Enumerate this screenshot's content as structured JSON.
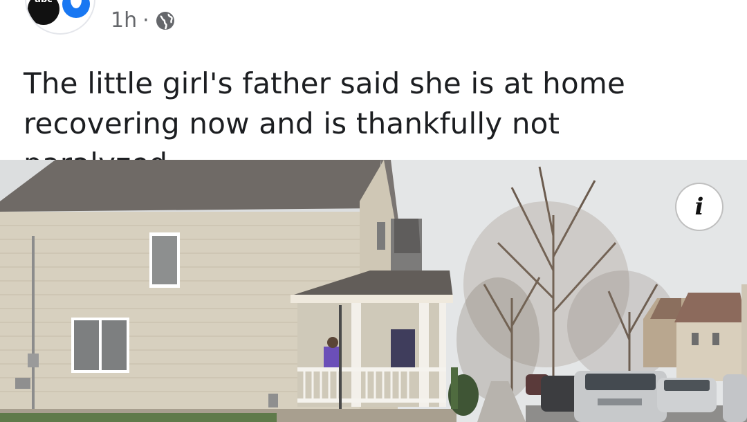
{
  "post": {
    "timestamp": "1h",
    "separator": "·",
    "visibility_icon": "globe-icon",
    "text": "The little girl's father said she is at home recovering now and is thankfully not paralyzed.",
    "avatar": {
      "logo_text": "abc"
    },
    "photo": {
      "info_icon_glyph": "i"
    }
  },
  "colors": {
    "meta_text": "#65676b",
    "body_text": "#1c1e21",
    "brand_blue": "#1877f2"
  }
}
